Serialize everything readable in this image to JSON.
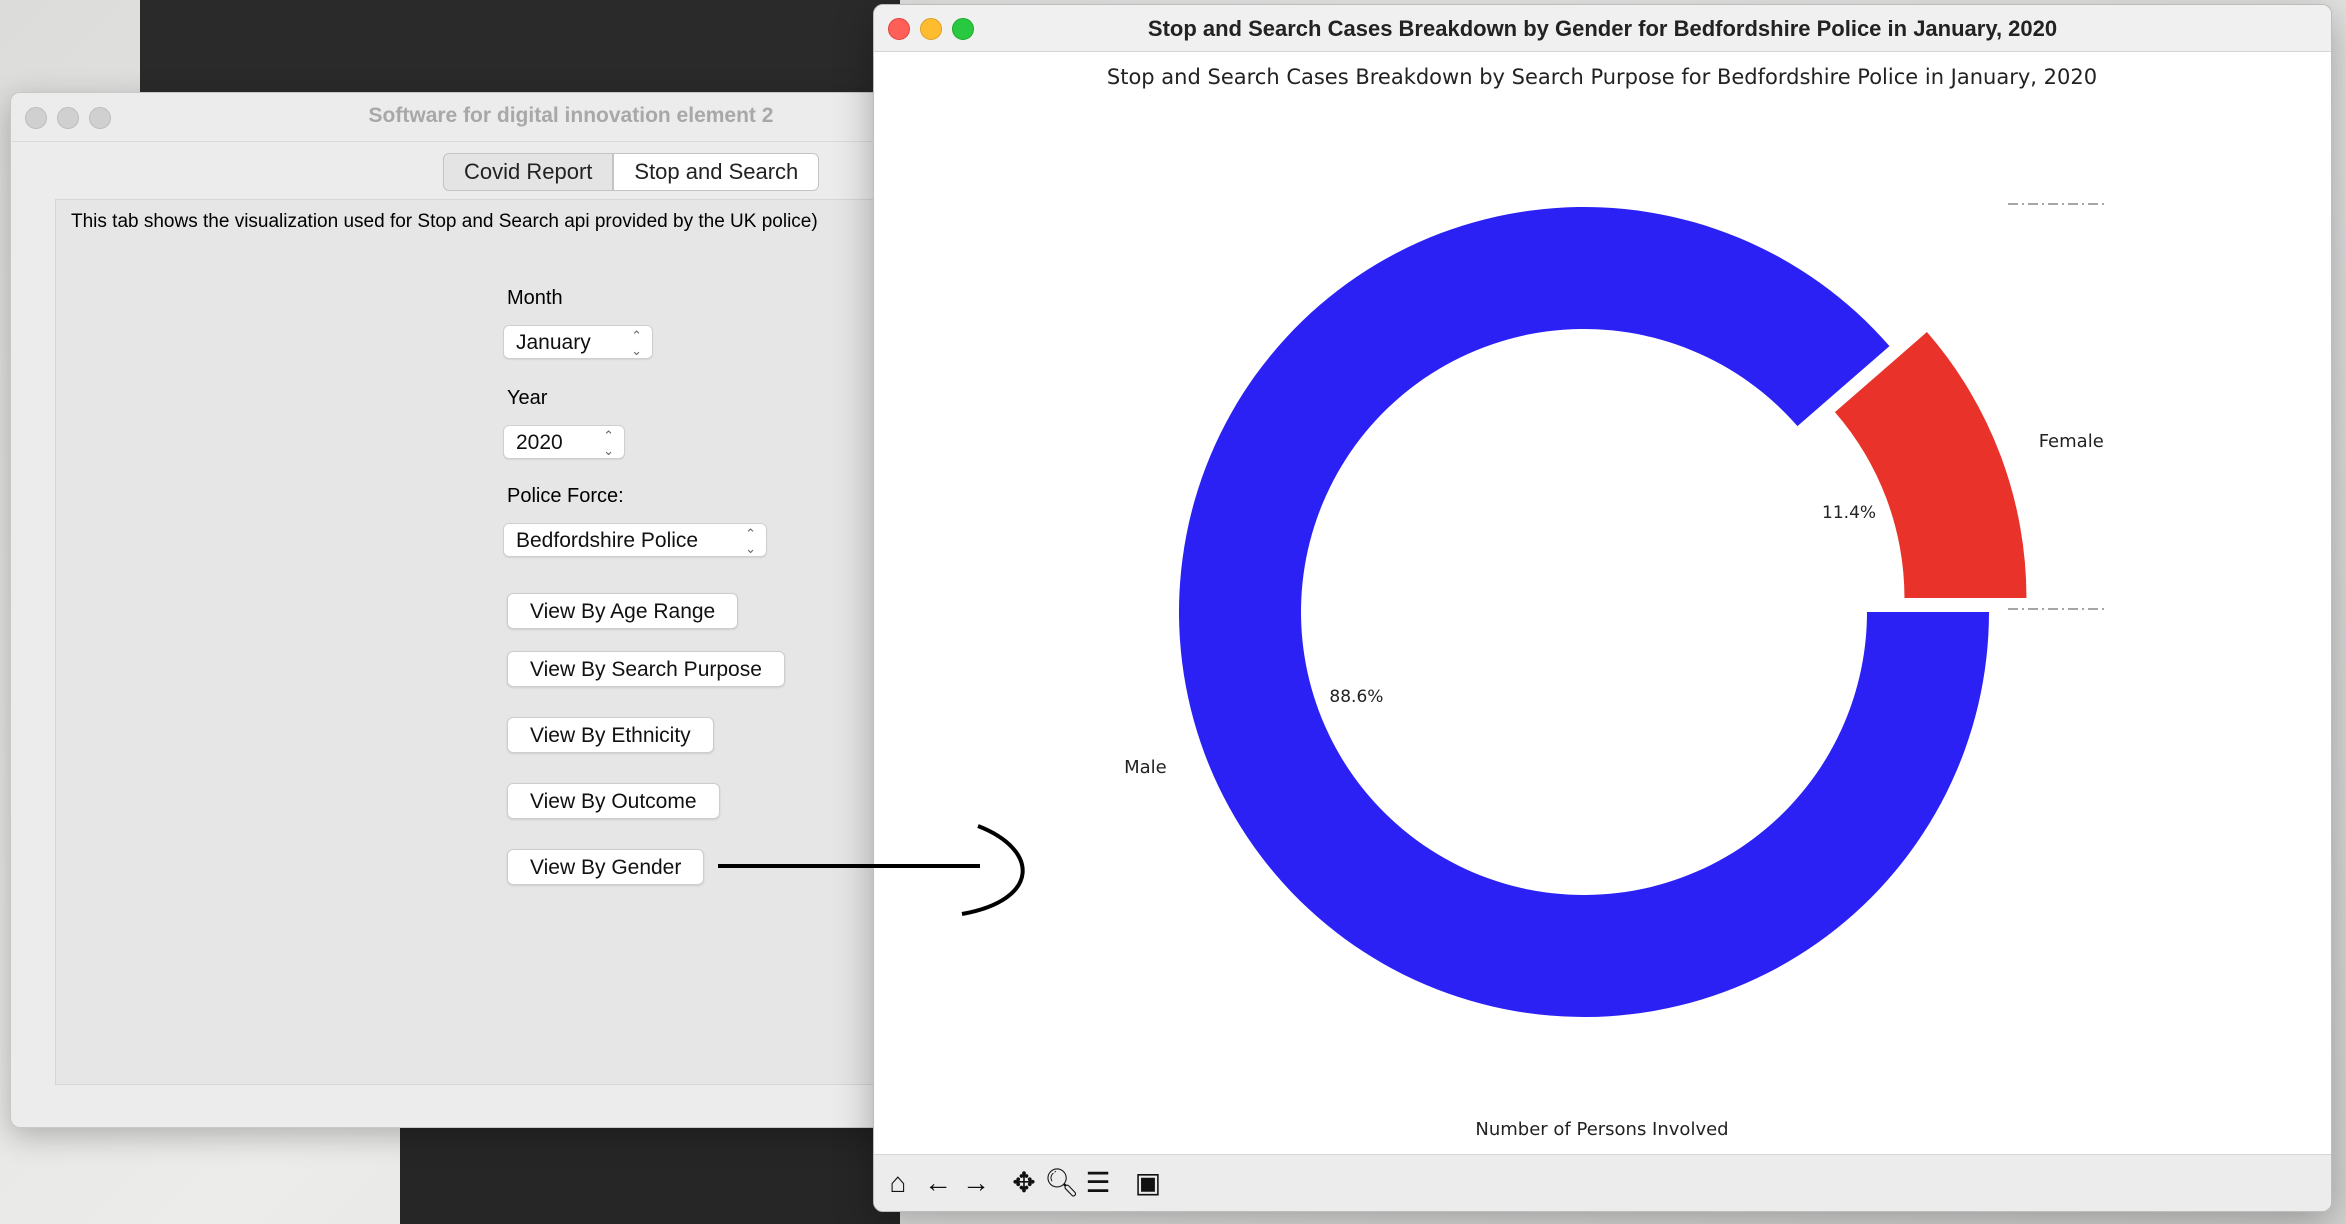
{
  "left_window": {
    "title": "Software for digital innovation element 2",
    "tabs": [
      {
        "label": "Covid Report"
      },
      {
        "label": "Stop and Search"
      }
    ],
    "description": "This tab shows the visualization used for Stop and Search api provided by the UK police)",
    "month_label": "Month",
    "month_value": "January",
    "year_label": "Year",
    "year_value": "2020",
    "police_force_label": "Police Force:",
    "police_force_value": "Bedfordshire Police",
    "buttons": [
      {
        "label": "View By Age Range"
      },
      {
        "label": "View By Search Purpose"
      },
      {
        "label": "View By Ethnicity"
      },
      {
        "label": "View By Outcome"
      },
      {
        "label": "View By Gender"
      }
    ]
  },
  "right_window": {
    "title": "Stop and Search Cases Breakdown by Gender for Bedfordshire Police in January, 2020",
    "toolbar": [
      "home-icon",
      "back-icon",
      "forward-icon",
      "pan-icon",
      "zoom-icon",
      "configure-subplots-icon",
      "save-icon"
    ]
  },
  "chart_data": {
    "type": "pie",
    "style": "donut",
    "title": "Stop and Search Cases Breakdown by Search Purpose for Bedfordshire Police in January, 2020",
    "xlabel": "Number of Persons Involved",
    "slices": [
      {
        "label": "Female",
        "value": 11.4,
        "pct_label": "11.4%",
        "color": "#e8322a",
        "exploded": true
      },
      {
        "label": "Male",
        "value": 88.6,
        "pct_label": "88.6%",
        "color": "#2b21f5",
        "exploded": false
      }
    ]
  },
  "colors": {
    "male": "#2b21f5",
    "female": "#e8322a",
    "traffic_red": "#fe5f57",
    "traffic_yellow": "#febc2e",
    "traffic_green": "#28c840"
  }
}
